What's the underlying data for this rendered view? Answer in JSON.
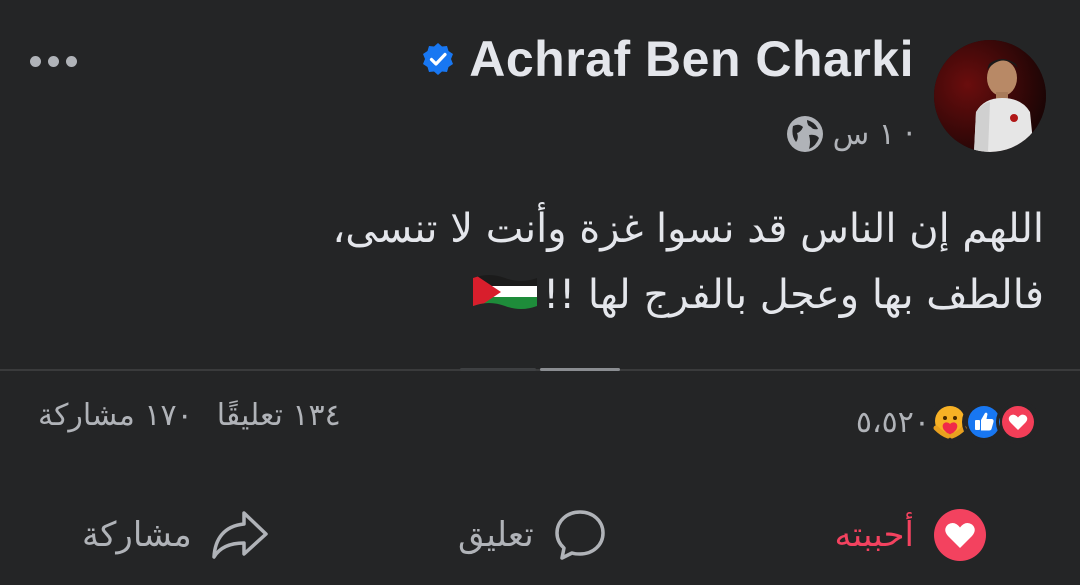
{
  "post": {
    "author": "Achraf Ben Charki",
    "time_ago": "١ س ·",
    "text": "اللهم إن الناس قد نسوا غزة وأنت لا تنسى،\nفالطف بها وعجل بالفرج لها !!",
    "flag_icon": "palestine-flag-emoji"
  },
  "reactions": {
    "count": "٥،٥٢٠",
    "icons": [
      "love-reaction-icon",
      "like-reaction-icon",
      "care-reaction-icon"
    ]
  },
  "stats": {
    "comments": "١٣٤ تعليقًا",
    "shares": "١٧٠ مشاركة"
  },
  "actions": {
    "like_label": "أحببته",
    "comment_label": "تعليق",
    "share_label": "مشاركة"
  },
  "colors": {
    "background": "#242526",
    "text": "#e4e6eb",
    "secondary": "#b0b3b8",
    "love": "#f3425f",
    "like": "#1877f2",
    "verified": "#1877f2"
  }
}
